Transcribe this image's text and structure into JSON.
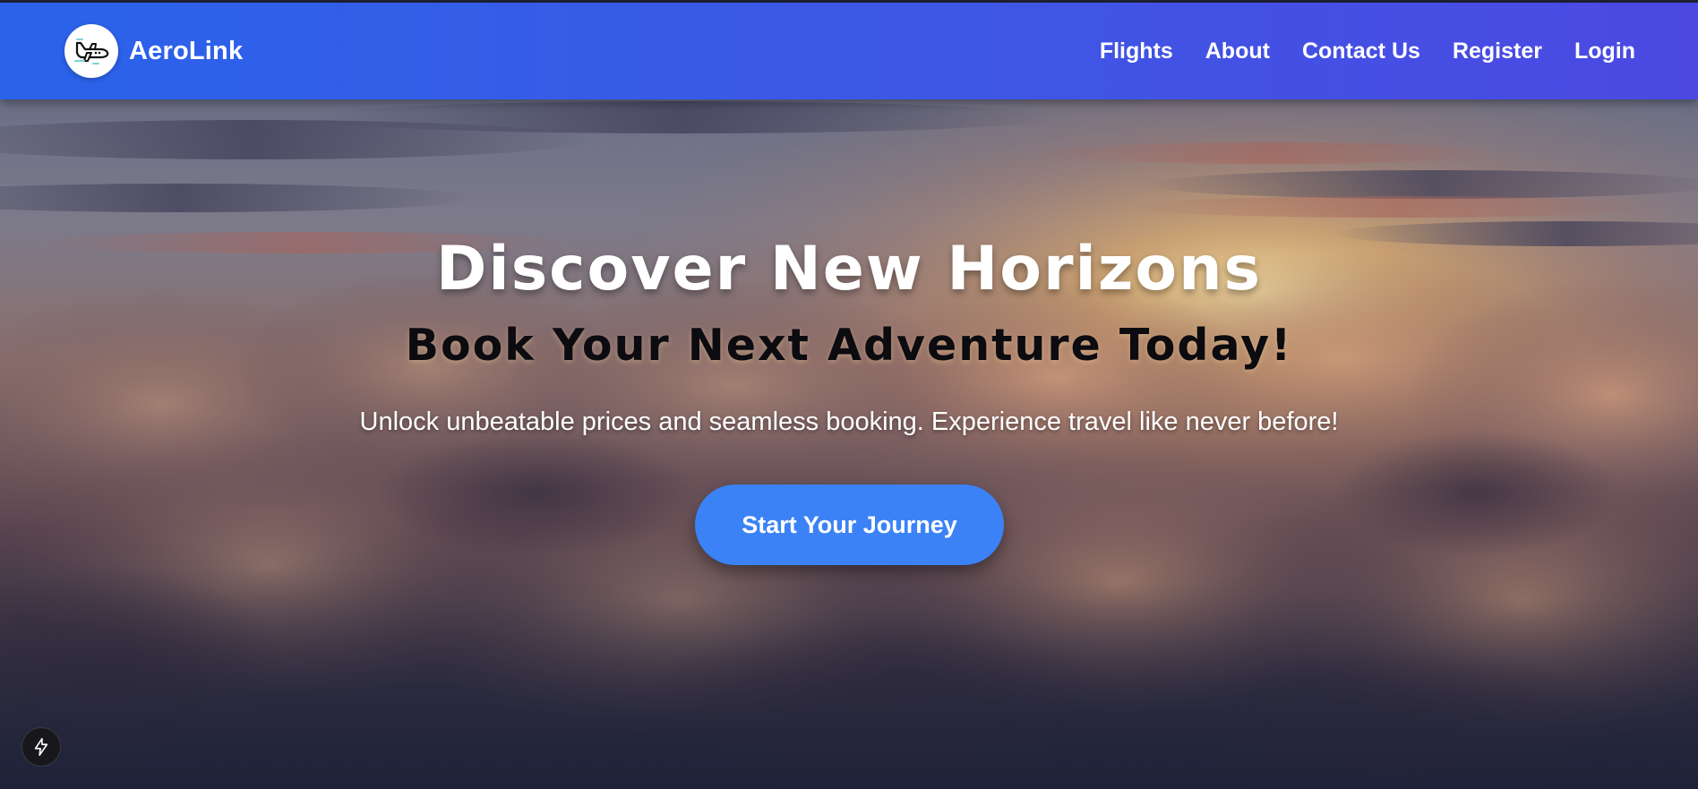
{
  "brand": {
    "name": "AeroLink",
    "logo_icon": "airplane-icon"
  },
  "nav": {
    "links": [
      "Flights",
      "About",
      "Contact Us",
      "Register",
      "Login"
    ]
  },
  "hero": {
    "headline": "Discover New Horizons",
    "subheadline": "Book Your Next Adventure Today!",
    "tagline": "Unlock unbeatable prices and seamless booking. Experience travel like never before!",
    "cta_label": "Start Your Journey",
    "background": "sunset-clouds-image"
  },
  "dev_tool": {
    "icon": "lightning-bolt-icon"
  },
  "colors": {
    "navbar_start": "#2a63ea",
    "navbar_end": "#4b49e2",
    "cta": "#3b82f6"
  }
}
